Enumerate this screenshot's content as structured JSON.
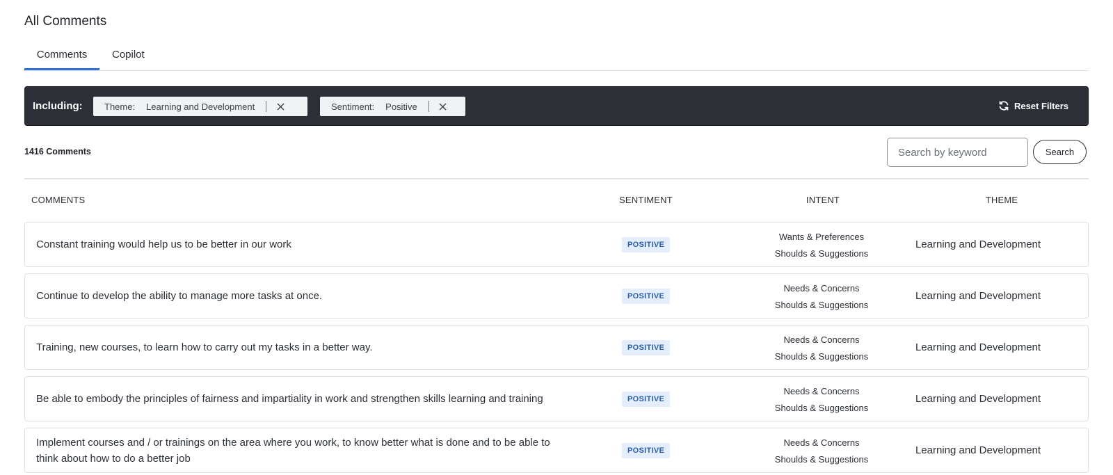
{
  "page": {
    "title": "All Comments"
  },
  "tabs": [
    {
      "label": "Comments",
      "active": true
    },
    {
      "label": "Copilot",
      "active": false
    }
  ],
  "filters": {
    "label": "Including:",
    "chips": [
      {
        "key": "Theme:",
        "value": "Learning and Development"
      },
      {
        "key": "Sentiment:",
        "value": "Positive"
      }
    ],
    "reset_label": "Reset Filters"
  },
  "summary": {
    "count_label": "1416 Comments"
  },
  "search": {
    "placeholder": "Search by keyword",
    "button_label": "Search"
  },
  "table": {
    "headers": {
      "comments": "COMMENTS",
      "sentiment": "SENTIMENT",
      "intent": "INTENT",
      "theme": "THEME"
    },
    "rows": [
      {
        "comment": "Constant training would help us to be better in our work",
        "sentiment": "POSITIVE",
        "intent": [
          "Wants & Preferences",
          "Shoulds & Suggestions"
        ],
        "theme": "Learning and Development"
      },
      {
        "comment": "Continue to develop the ability to manage more tasks at once.",
        "sentiment": "POSITIVE",
        "intent": [
          "Needs & Concerns",
          "Shoulds & Suggestions"
        ],
        "theme": "Learning and Development"
      },
      {
        "comment": "Training, new courses, to learn how to carry out my tasks in a better way.",
        "sentiment": "POSITIVE",
        "intent": [
          "Needs & Concerns",
          "Shoulds & Suggestions"
        ],
        "theme": "Learning and Development"
      },
      {
        "comment": "Be able to embody the principles of fairness and impartiality in work and strengthen skills learning and training",
        "sentiment": "POSITIVE",
        "intent": [
          "Needs & Concerns",
          "Shoulds & Suggestions"
        ],
        "theme": "Learning and Development"
      },
      {
        "comment": "Implement courses and / or trainings on the area where you work, to know better what is done and to be able to think about how to do a better job",
        "sentiment": "POSITIVE",
        "intent": [
          "Needs & Concerns",
          "Shoulds & Suggestions"
        ],
        "theme": "Learning and Development"
      }
    ]
  },
  "colors": {
    "accent": "#2f6fd6",
    "filter_bar": "#2c2f36",
    "badge_bg": "#e4eefb",
    "badge_text": "#2a5db0"
  },
  "icons": {
    "chip_remove": "close-icon",
    "reset": "refresh-icon"
  }
}
